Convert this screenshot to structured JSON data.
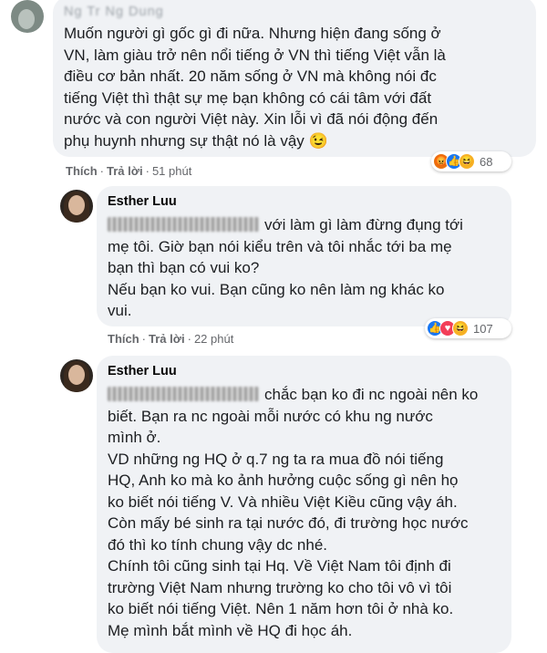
{
  "comments": [
    {
      "author": "Ng Tr Ng Dung",
      "text": "Muốn người gì gốc gì đi nữa. Nhưng hiện đang sống ở\nVN, làm giàu trở nên nổi tiếng ở VN thì tiếng Việt vẫn là\nđiều cơ bản nhất. 20 năm sống ở VN mà không nói đc\ntiếng Việt thì thật sự mẹ bạn không có cái tâm với đất\nnước và con người Việt này. Xin lỗi vì đã nói động đến\nphụ huynh nhưng sự thật nó là vậy 😉",
      "like": "Thích",
      "reply": "Trả lời",
      "time": "51 phút",
      "reactions": [
        "angry",
        "like",
        "haha"
      ],
      "reaction_count": "68"
    },
    {
      "author": "Esther Luu",
      "text_after_mention": "với làm gì làm đừng đụng tới\nmẹ tôi. Giờ bạn nói kiểu trên và tôi nhắc tới ba mẹ\nbạn thì bạn có vui ko?\nNếu bạn ko vui. Bạn cũng ko nên làm ng khác ko\nvui.",
      "like": "Thích",
      "reply": "Trả lời",
      "time": "22 phút",
      "reactions": [
        "like",
        "love",
        "haha"
      ],
      "reaction_count": "107"
    },
    {
      "author": "Esther Luu",
      "text_after_mention": "chắc bạn ko đi nc ngoài nên ko\nbiết. Bạn ra nc ngoài mỗi nước có khu ng nước\nmình ở.\nVD những ng HQ ở q.7 ng ta ra mua đồ nói tiếng\nHQ, Anh ko mà ko ảnh hưởng cuộc sống gì nên họ\nko biết nói tiếng V. Và nhiều Việt Kiều cũng vậy áh.\nCòn mấy bé sinh ra tại nước đó, đi trường học nước\nđó thì ko tính chung vậy dc nhé.\nChính tôi cũng sinh tại Hq. Về Việt Nam tôi định đi\ntrường Việt Nam nhưng trường ko cho tôi vô vì tôi\nko biết nói tiếng Việt. Nên 1 năm hơn tôi ở nhà ko.\nMẹ mình bắt mình về HQ đi học áh."
    }
  ]
}
